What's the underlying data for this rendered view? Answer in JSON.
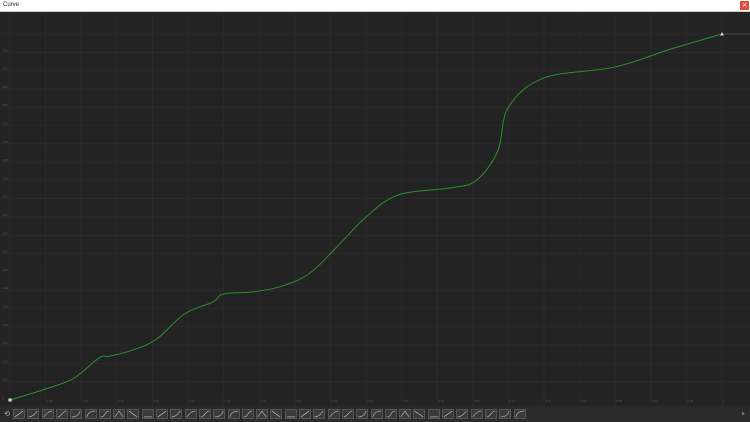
{
  "window": {
    "title": "Curve",
    "close_label": "×"
  },
  "colors": {
    "background": "#232323",
    "grid": "#2e2e2e",
    "curve": "#2f8f2f",
    "titlebar": "#ffffff",
    "close": "#e04a3b"
  },
  "chart_data": {
    "type": "line",
    "xlim": [
      0,
      1
    ],
    "ylim": [
      0,
      1
    ],
    "x_ticks": [
      "0",
      "0.05",
      "0.10",
      "0.15",
      "0.20",
      "0.25",
      "0.30",
      "0.35",
      "0.40",
      "0.45",
      "0.50",
      "0.55",
      "0.60",
      "0.65",
      "0.70",
      "0.75",
      "0.80",
      "0.85",
      "0.90",
      "0.95",
      "1"
    ],
    "y_ticks": [
      "1",
      "0.95",
      "0.90",
      "0.85",
      "0.80",
      "0.75",
      "0.70",
      "0.65",
      "0.60",
      "0.55",
      "0.50",
      "0.45",
      "0.40",
      "0.35",
      "0.30",
      "0.25",
      "0.20",
      "0.15",
      "0.10",
      "0.05",
      "0"
    ],
    "points": [
      {
        "x": 0.0,
        "y": 0.0
      },
      {
        "x": 0.05,
        "y": 0.03
      },
      {
        "x": 0.09,
        "y": 0.06
      },
      {
        "x": 0.125,
        "y": 0.115
      },
      {
        "x": 0.14,
        "y": 0.12
      },
      {
        "x": 0.17,
        "y": 0.135
      },
      {
        "x": 0.205,
        "y": 0.165
      },
      {
        "x": 0.245,
        "y": 0.235
      },
      {
        "x": 0.285,
        "y": 0.268
      },
      {
        "x": 0.3,
        "y": 0.29
      },
      {
        "x": 0.34,
        "y": 0.295
      },
      {
        "x": 0.38,
        "y": 0.31
      },
      {
        "x": 0.42,
        "y": 0.345
      },
      {
        "x": 0.46,
        "y": 0.42
      },
      {
        "x": 0.5,
        "y": 0.5
      },
      {
        "x": 0.545,
        "y": 0.56
      },
      {
        "x": 0.62,
        "y": 0.58
      },
      {
        "x": 0.655,
        "y": 0.6
      },
      {
        "x": 0.685,
        "y": 0.68
      },
      {
        "x": 0.7,
        "y": 0.8
      },
      {
        "x": 0.75,
        "y": 0.88
      },
      {
        "x": 0.85,
        "y": 0.91
      },
      {
        "x": 0.93,
        "y": 0.96
      },
      {
        "x": 1.0,
        "y": 1.0
      }
    ],
    "grid": true
  },
  "toolbar": {
    "left_icon": "curve-reset-icon",
    "preset_count": 36,
    "presets": [
      "linear",
      "ease-in-sine",
      "ease-out-sine",
      "ease-in-out-sine",
      "ease-in-quad",
      "ease-out-quad",
      "ease-in-out-quad",
      "ease-in-cubic",
      "ease-out-cubic",
      "ease-in-out-cubic",
      "ease-in-quart",
      "ease-out-quart",
      "ease-in-out-quart",
      "ease-in-quint",
      "ease-out-quint",
      "ease-in-out-quint",
      "ease-in-expo",
      "ease-out-expo",
      "ease-in-out-expo",
      "ease-in-circ",
      "ease-out-circ",
      "ease-in-out-circ",
      "ease-in-back",
      "ease-out-back",
      "ease-in-out-back",
      "ease-in-elastic",
      "ease-out-elastic",
      "ease-in-out-elastic",
      "ease-in-bounce",
      "ease-out-bounce",
      "ease-in-out-bounce",
      "step",
      "smooth",
      "constant",
      "spike",
      "wave"
    ]
  }
}
